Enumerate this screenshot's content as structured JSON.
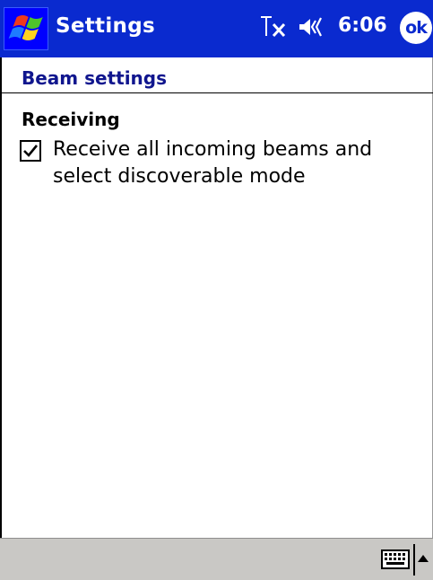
{
  "titlebar": {
    "app_title": "Settings",
    "clock": "6:06",
    "ok_label": "ok",
    "icons": {
      "start": "windows-flag-icon",
      "connectivity": "connectivity-icon",
      "volume": "speaker-volume-icon"
    },
    "colors": {
      "background": "#0a2acf",
      "text": "#ffffff"
    }
  },
  "header": {
    "title": "Beam settings",
    "color": "#10168e"
  },
  "content": {
    "section_heading": "Receiving",
    "receive_option": {
      "label": "Receive all incoming beams and select discoverable mode",
      "checked": true
    }
  },
  "bottombar": {
    "icons": {
      "keyboard": "keyboard-icon",
      "sip_toggle": "up-arrow-icon"
    },
    "background": "#c9c8c5"
  }
}
